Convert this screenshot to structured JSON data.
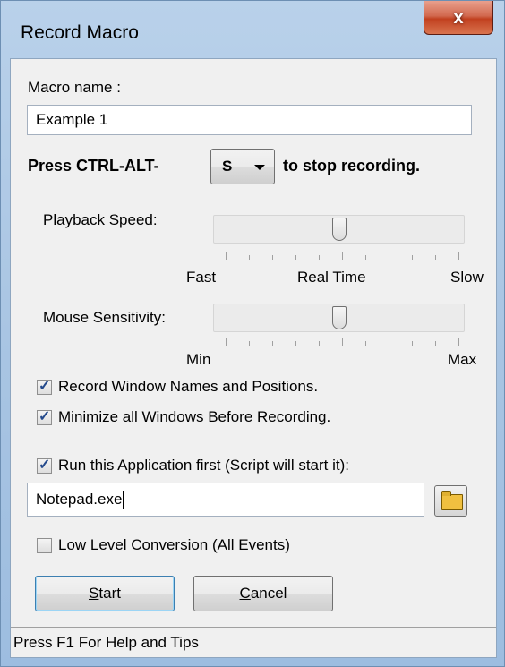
{
  "window": {
    "title": "Record Macro",
    "close_glyph": "x"
  },
  "macro_name": {
    "label": "Macro name :",
    "value": "Example 1"
  },
  "hotkey": {
    "prefix": "Press CTRL-ALT-",
    "key": "S",
    "suffix": "to stop recording."
  },
  "playback_speed": {
    "label": "Playback Speed:",
    "min_label": "Fast",
    "mid_label": "Real Time",
    "max_label": "Slow",
    "level": 0.5
  },
  "mouse_sensitivity": {
    "label": "Mouse Sensitivity:",
    "min_label": "Min",
    "max_label": "Max",
    "level": 0.5
  },
  "options": {
    "record_window_names": {
      "label": "Record Window Names and Positions.",
      "checked": true
    },
    "minimize_windows": {
      "label": "Minimize all Windows Before Recording.",
      "checked": true
    },
    "run_application": {
      "label": "Run this Application first (Script will start it):",
      "checked": true
    },
    "low_level_conversion": {
      "label": "Low Level Conversion (All Events)",
      "checked": false
    }
  },
  "application_path": {
    "value": "Notepad.exe"
  },
  "buttons": {
    "start_key": "S",
    "start_rest": "tart",
    "cancel_key": "C",
    "cancel_rest": "ancel"
  },
  "status": {
    "text": "Press F1 For Help and Tips"
  },
  "icons": {
    "close": "close-icon",
    "dropdown": "chevron-down-icon",
    "browse": "folder-open-icon",
    "check": "checkmark-icon"
  },
  "colors": {
    "titlebar": "#b9d1ea",
    "close_button": "#c1401f",
    "dialog_background": "#f0f0f0",
    "check": "#244a8c"
  }
}
